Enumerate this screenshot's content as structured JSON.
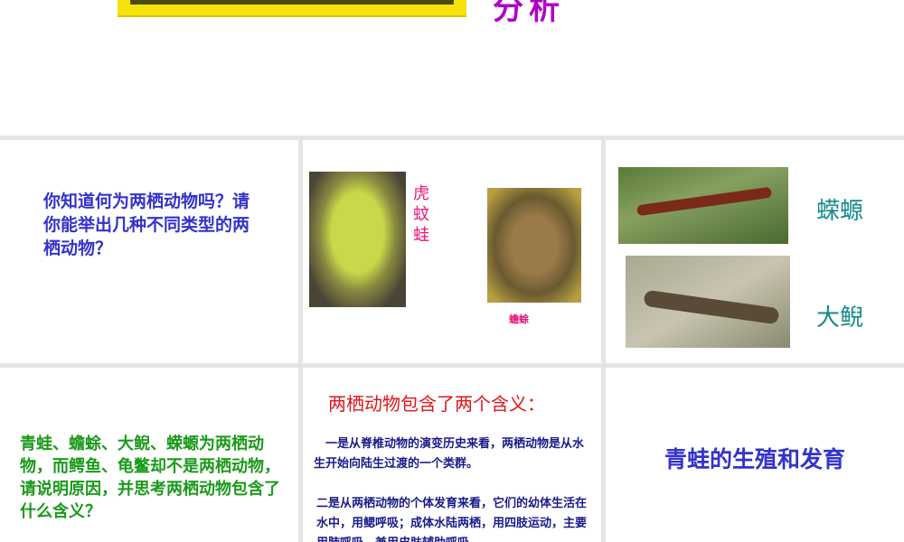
{
  "header": {
    "title_fragment": "分析"
  },
  "cell1": {
    "question": "你知道何为两栖动物吗？请你能举出几种不同类型的两栖动物？"
  },
  "cell2": {
    "label_frog": "虎蚊蛙",
    "label_toad": "蟾蜍"
  },
  "cell3": {
    "label_newt": "蝾螈",
    "label_salamander": "大鲵"
  },
  "cell4": {
    "question": "青蛙、蟾蜍、大鲵、蝾螈为两栖动物，而鳄鱼、龟鳖却不是两栖动物，请说明原因，并思考两栖动物包含了什么含义？"
  },
  "cell5": {
    "heading": "两栖动物包含了两个含义：",
    "para1": "　一是从脊椎动物的演变历史来看，两栖动物是从水生开始向陆生过渡的一个类群。",
    "para2": "二是从两栖动物的个体发育来看，它们的幼体生活在水中，用鳃呼吸；成体水陆两栖，用四肢运动，主要用肺呼吸，兼用皮肤辅助呼吸。"
  },
  "cell6": {
    "title": "青蛙的生殖和发育"
  }
}
